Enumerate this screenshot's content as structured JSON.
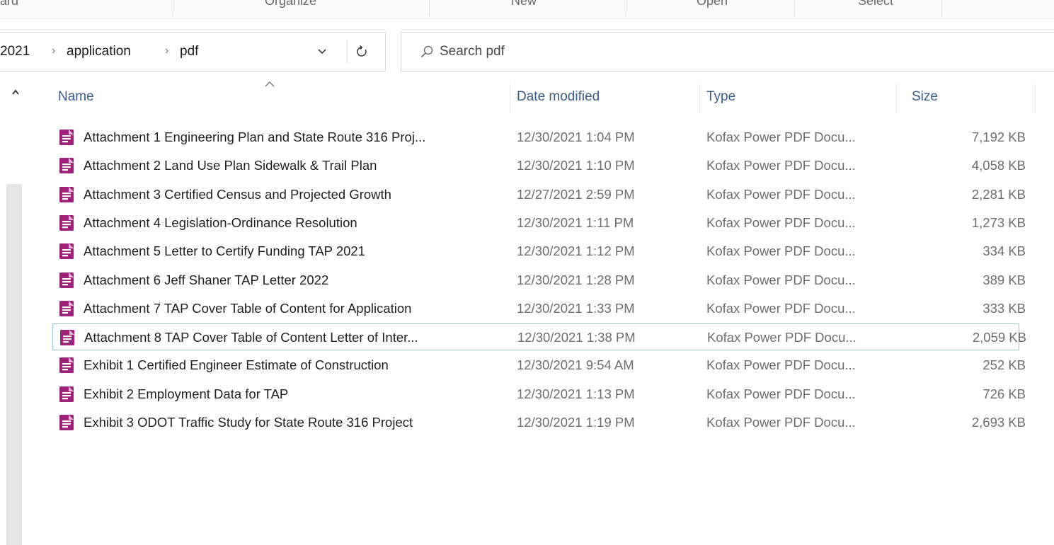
{
  "ribbon": {
    "groups": [
      "ard",
      "Organize",
      "New",
      "Open",
      "Select"
    ]
  },
  "address": {
    "crumbs": [
      "2021",
      "application",
      "pdf"
    ]
  },
  "search": {
    "placeholder": "Search pdf"
  },
  "columns": {
    "name": "Name",
    "date": "Date modified",
    "type": "Type",
    "size": "Size"
  },
  "files": [
    {
      "name": "Attachment 1 Engineering Plan and State Route 316 Proj...",
      "date": "12/30/2021 1:04 PM",
      "type": "Kofax Power PDF Docu...",
      "size": "7,192 KB"
    },
    {
      "name": "Attachment 2 Land Use Plan Sidewalk & Trail Plan",
      "date": "12/30/2021 1:10 PM",
      "type": "Kofax Power PDF Docu...",
      "size": "4,058 KB"
    },
    {
      "name": "Attachment 3 Certified Census and Projected Growth",
      "date": "12/27/2021 2:59 PM",
      "type": "Kofax Power PDF Docu...",
      "size": "2,281 KB"
    },
    {
      "name": "Attachment 4 Legislation-Ordinance Resolution",
      "date": "12/30/2021 1:11 PM",
      "type": "Kofax Power PDF Docu...",
      "size": "1,273 KB"
    },
    {
      "name": "Attachment 5 Letter to Certify Funding TAP 2021",
      "date": "12/30/2021 1:12 PM",
      "type": "Kofax Power PDF Docu...",
      "size": "334 KB"
    },
    {
      "name": "Attachment 6 Jeff Shaner TAP Letter 2022",
      "date": "12/30/2021 1:28 PM",
      "type": "Kofax Power PDF Docu...",
      "size": "389 KB"
    },
    {
      "name": "Attachment 7 TAP Cover Table of Content for Application",
      "date": "12/30/2021 1:33 PM",
      "type": "Kofax Power PDF Docu...",
      "size": "333 KB"
    },
    {
      "name": "Attachment 8 TAP Cover Table of Content Letter of Inter...",
      "date": "12/30/2021 1:38 PM",
      "type": "Kofax Power PDF Docu...",
      "size": "2,059 KB"
    },
    {
      "name": "Exhibit 1 Certified Engineer Estimate of Construction",
      "date": "12/30/2021 9:54 AM",
      "type": "Kofax Power PDF Docu...",
      "size": "252 KB"
    },
    {
      "name": "Exhibit 2 Employment Data for TAP",
      "date": "12/30/2021 1:13 PM",
      "type": "Kofax Power PDF Docu...",
      "size": "726 KB"
    },
    {
      "name": "Exhibit 3 ODOT Traffic Study  for State Route 316 Project",
      "date": "12/30/2021 1:19 PM",
      "type": "Kofax Power PDF Docu...",
      "size": "2,693 KB"
    }
  ],
  "icons": {
    "file": "pdf-file-icon",
    "search": "search-icon",
    "refresh": "refresh-icon",
    "dropdown": "chevron-down-icon",
    "sort": "sort-ascending-icon",
    "scroll_up": "chevron-up-icon"
  },
  "colors": {
    "pdf_icon": "#a0217a",
    "header_text": "#3b5b8b",
    "focus_border": "#9fc3e8"
  }
}
